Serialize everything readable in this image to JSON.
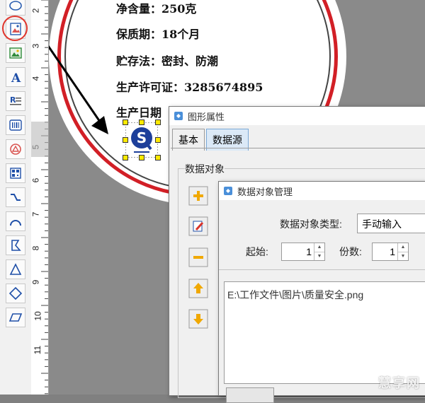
{
  "label_preview": {
    "lines": [
      "净含量：250克",
      "保质期：18个月",
      "贮存法：密封、防潮",
      "生产许可证：3285674895",
      "生产日期"
    ]
  },
  "ruler": {
    "numbers": [
      "2",
      "3",
      "4",
      "5",
      "6",
      "7",
      "8",
      "9",
      "10",
      "11"
    ]
  },
  "toolbar": {
    "tools": [
      "ellipse-icon",
      "image-icon",
      "picture-icon",
      "text-icon",
      "rich-text-icon",
      "barcode-icon",
      "shape-icon",
      "qr-icon",
      "line-icon",
      "arc-icon",
      "polygon-icon",
      "triangle-icon",
      "diamond-icon",
      "parallelogram-icon"
    ],
    "highlight_color": "#e0342b"
  },
  "graphic_props_dialog": {
    "title": "图形属性",
    "tabs": [
      "基本",
      "数据源"
    ],
    "active_tab": "数据源",
    "group_label": "数据对象",
    "side_buttons": [
      "add-icon",
      "edit-icon",
      "remove-icon",
      "move-up-icon",
      "move-down-icon"
    ]
  },
  "data_object_dialog": {
    "title": "数据对象管理",
    "type_label": "数据对象类型:",
    "type_value": "手动输入",
    "start_label": "起始:",
    "start_value": "1",
    "copies_label": "份数:",
    "copies_value": "1",
    "content": "E:\\工作文件\\图片\\质量安全.png"
  },
  "watermark": "慧享网",
  "colors": {
    "ring": "#d21f26",
    "handle": "#ffea00",
    "tab_active": "#dbe9f7"
  }
}
